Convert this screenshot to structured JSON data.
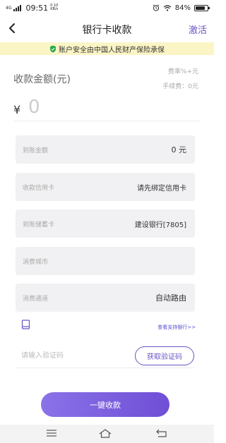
{
  "status_bar": {
    "signal": "4G",
    "time": "09:51",
    "speed_value": "0.10",
    "speed_unit": "KB/s",
    "battery": "84%",
    "battery_level": 0.84
  },
  "nav": {
    "title": "银行卡收款",
    "action": "激活"
  },
  "notice": {
    "text": "账户安全由中国人民财产保险承保"
  },
  "amount": {
    "label": "收款金额(元)",
    "rate": "费率%+元",
    "fee": "手续费：0元",
    "currency": "¥",
    "placeholder": "0"
  },
  "fields": [
    {
      "label": "到账金额",
      "value": "0 元"
    },
    {
      "label": "收款信用卡",
      "value": "请先绑定信用卡"
    },
    {
      "label": "到账储蓄卡",
      "value": "建设银行[7805]"
    },
    {
      "label": "消费城市",
      "value": ""
    },
    {
      "label": "消费通道",
      "value": "自动路由"
    }
  ],
  "supported_banks_link": "查看支持银行>>",
  "verification": {
    "placeholder": "请输入验证码",
    "button": "获取验证码"
  },
  "submit": {
    "label": "一键收款"
  },
  "colors": {
    "accent": "#6b54c6",
    "notice_bg": "#fbf5c5",
    "field_bg": "#f1f1f3"
  }
}
